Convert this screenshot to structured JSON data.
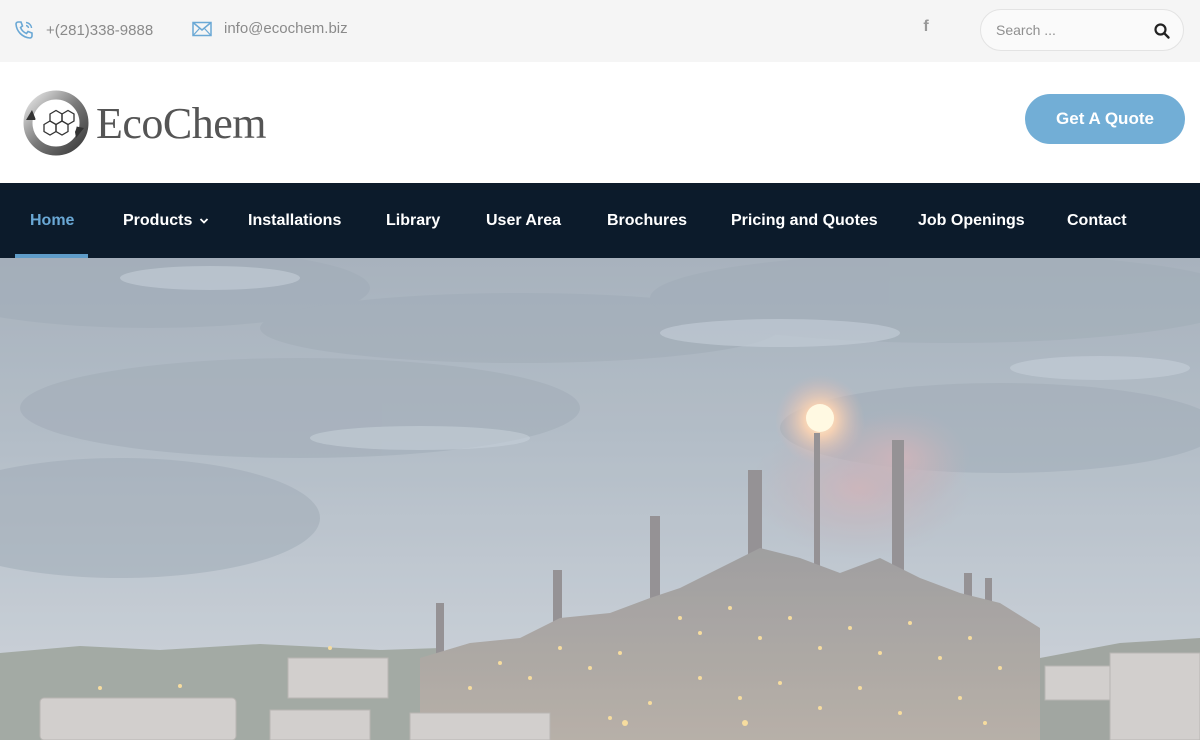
{
  "topbar": {
    "phone": "+(281)338-9888",
    "email": "info@ecochem.biz",
    "social_icon": "facebook-icon",
    "search_placeholder": "Search ..."
  },
  "header": {
    "logo_text": "EcoChem",
    "quote_button": "Get A Quote"
  },
  "nav": {
    "items": [
      {
        "label": "Home",
        "active": true
      },
      {
        "label": "Products",
        "dropdown": true
      },
      {
        "label": "Installations"
      },
      {
        "label": "Library"
      },
      {
        "label": "User Area"
      },
      {
        "label": "Brochures"
      },
      {
        "label": "Pricing and Quotes"
      },
      {
        "label": "Job Openings"
      },
      {
        "label": "Contact"
      }
    ]
  },
  "colors": {
    "accent": "#72aed6",
    "nav_bg": "#0c1b2b",
    "active_nav": "#6aa8d5"
  }
}
